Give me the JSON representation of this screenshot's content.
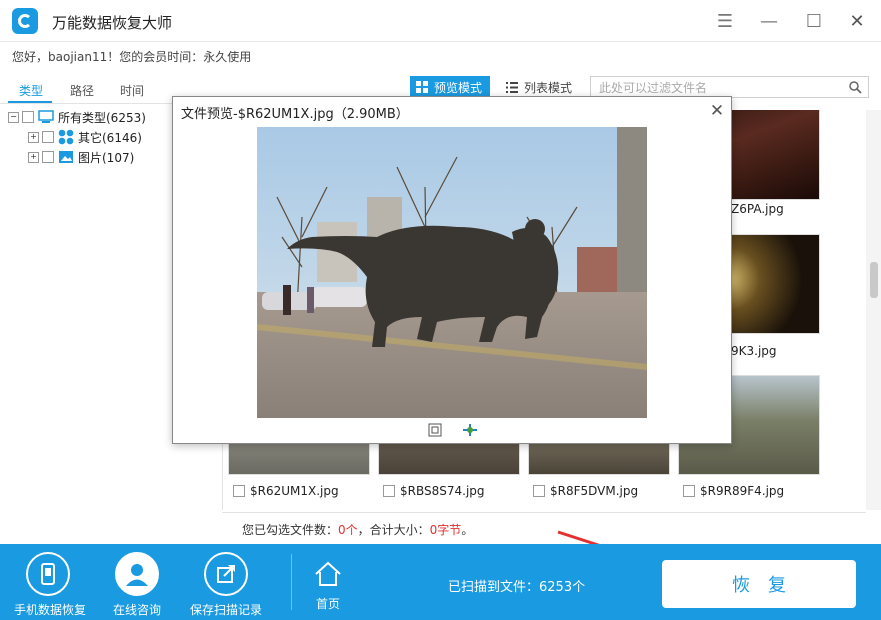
{
  "app": {
    "title": "万能数据恢复大师"
  },
  "window_controls": {
    "menu": "☰",
    "minimize": "—",
    "maximize": "☐",
    "close": "✕"
  },
  "welcome": "您好，baojian11！您的会员时间：永久使用",
  "tabs": [
    {
      "label": "类型"
    },
    {
      "label": "路径"
    },
    {
      "label": "时间"
    }
  ],
  "tree": [
    {
      "label": "所有类型(6253)",
      "expander": "⊟",
      "icon": "computer-icon"
    },
    {
      "label": "其它(6146)",
      "expander": "⊞",
      "icon": "apps-icon"
    },
    {
      "label": "图片(107)",
      "expander": "⊞",
      "icon": "picture-icon"
    }
  ],
  "view_modes": {
    "preview": "预览模式",
    "list": "列表模式"
  },
  "search": {
    "placeholder": "此处可以过滤文件名"
  },
  "grid": {
    "right_column": [
      "Z6PA.jpg",
      "9K3.jpg"
    ],
    "bottom_row": [
      "$R62UM1X.jpg",
      "$RBS8S74.jpg",
      "$R8F5DVM.jpg",
      "$R9R89F4.jpg"
    ]
  },
  "status": {
    "prefix": "您已勾选文件数：",
    "count": "0个",
    "middle": "，合计大小：",
    "size": "0字节",
    "suffix": "。"
  },
  "bottom": {
    "phone_recover": "手机数据恢复",
    "consult": "在线咨询",
    "save_scan": "保存扫描记录",
    "home": "首页",
    "scan_count": "已扫描到文件：6253个",
    "recover": "恢复"
  },
  "dialog": {
    "title": "文件预览-$R62UM1X.jpg（2.90MB）",
    "close": "✕"
  },
  "colors": {
    "accent": "#1a9ae0",
    "red": "#e03030"
  }
}
